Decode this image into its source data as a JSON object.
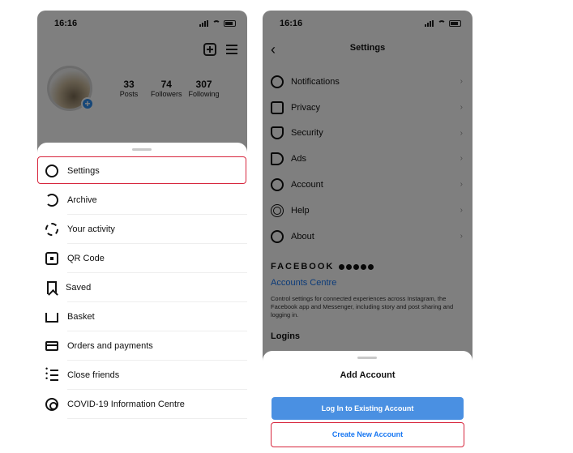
{
  "left_screen": {
    "time": "16:16",
    "stats": [
      {
        "value": "33",
        "label": "Posts"
      },
      {
        "value": "74",
        "label": "Followers"
      },
      {
        "value": "307",
        "label": "Following"
      }
    ],
    "menu": [
      {
        "label": "Settings",
        "icon": "gear-icon"
      },
      {
        "label": "Archive",
        "icon": "archive-icon"
      },
      {
        "label": "Your activity",
        "icon": "activity-icon"
      },
      {
        "label": "QR Code",
        "icon": "qr-code-icon"
      },
      {
        "label": "Saved",
        "icon": "bookmark-icon"
      },
      {
        "label": "Basket",
        "icon": "basket-icon"
      },
      {
        "label": "Orders and payments",
        "icon": "card-icon"
      },
      {
        "label": "Close friends",
        "icon": "close-friends-icon"
      },
      {
        "label": "COVID-19 Information Centre",
        "icon": "covid-icon"
      }
    ]
  },
  "right_screen": {
    "time": "16:16",
    "title": "Settings",
    "items": [
      {
        "label": "Notifications",
        "icon": "bell-icon"
      },
      {
        "label": "Privacy",
        "icon": "lock-icon"
      },
      {
        "label": "Security",
        "icon": "shield-icon"
      },
      {
        "label": "Ads",
        "icon": "megaphone-icon"
      },
      {
        "label": "Account",
        "icon": "account-icon"
      },
      {
        "label": "Help",
        "icon": "help-icon"
      },
      {
        "label": "About",
        "icon": "info-icon"
      }
    ],
    "facebook_label": "FACEBOOK",
    "accounts_centre": "Accounts Centre",
    "accounts_desc": "Control settings for connected experiences across Instagram, the Facebook app and Messenger, including story and post sharing and logging in.",
    "logins": "Logins",
    "sheet": {
      "title": "Add Account",
      "login_button": "Log In to Existing Account",
      "create_button": "Create New Account"
    }
  },
  "colors": {
    "highlight": "#d7263d",
    "primary_button": "#4a90e2",
    "link": "#1877f2",
    "add_badge": "#2f8ff0"
  }
}
